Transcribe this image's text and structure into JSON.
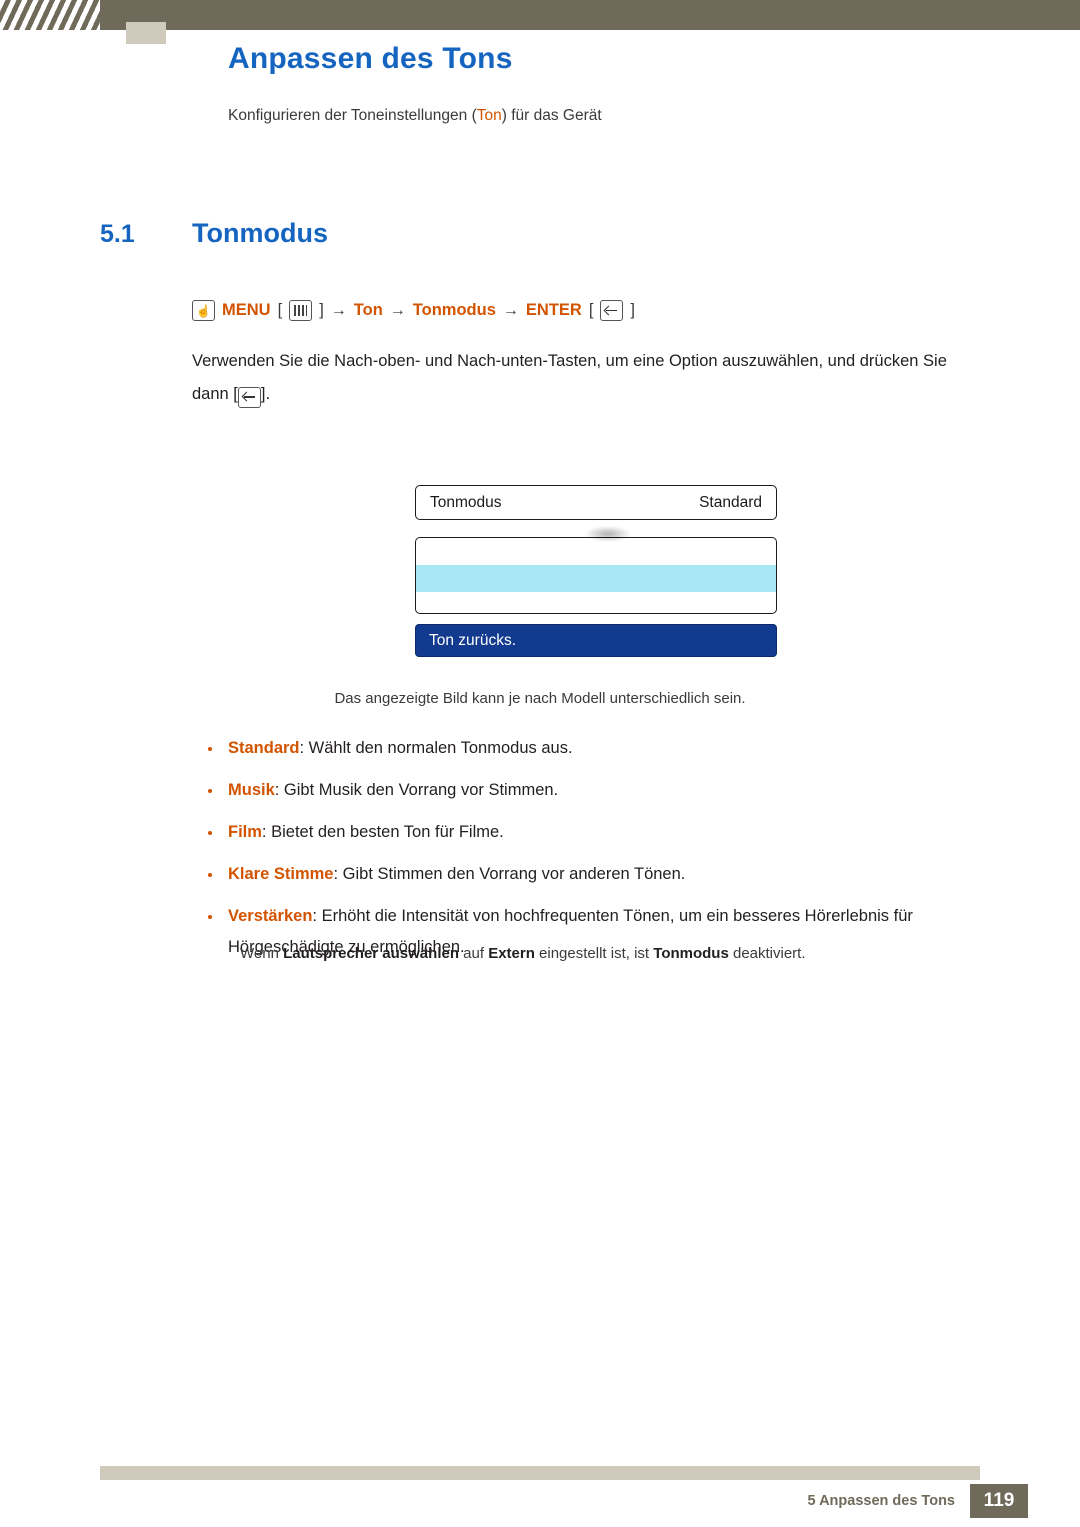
{
  "header": {
    "chapter_title": "Anpassen des Tons",
    "chapter_subtitle_pre": "Konfigurieren der Toneinstellungen (",
    "chapter_subtitle_hl": "Ton",
    "chapter_subtitle_post": ") für das Gerät"
  },
  "section": {
    "number": "5.1",
    "title": "Tonmodus"
  },
  "path": {
    "menu_label": "MENU",
    "arrow": "→",
    "step2": "Ton",
    "step3": "Tonmodus",
    "enter_label": "ENTER",
    "bracket_open": "[",
    "bracket_close": "]",
    "hand_icon": "hand-pointer-icon",
    "menu_icon": "menu-bars-icon",
    "enter_icon": "enter-arrow-icon"
  },
  "paragraph": {
    "line1": "Verwenden Sie die Nach-oben- und Nach-unten-Tasten, um eine Option auszuwählen, und drücken Sie",
    "line2_pre": "dann [",
    "line2_post": "]."
  },
  "osd": {
    "row_label": "Tonmodus",
    "row_value": "Standard",
    "bottom_label": "Ton zurücks."
  },
  "caption": "Das angezeigte Bild kann je nach Modell unterschiedlich sein.",
  "bullets": [
    {
      "term": "Standard",
      "text": ": Wählt den normalen Tonmodus aus."
    },
    {
      "term": "Musik",
      "text": ": Gibt Musik den Vorrang vor Stimmen."
    },
    {
      "term": "Film",
      "text": ": Bietet den besten Ton für Filme."
    },
    {
      "term": "Klare Stimme",
      "text": ": Gibt Stimmen den Vorrang vor anderen Tönen."
    },
    {
      "term": "Verstärken",
      "text": ": Erhöht die Intensität von hochfrequenten Tönen, um ein besseres Hörerlebnis für Hörgeschädigte zu ermöglichen."
    }
  ],
  "note": {
    "pre": "Wenn ",
    "b1": "Lautsprecher auswählen",
    "mid1": " auf ",
    "b2": "Extern",
    "mid2": " eingestellt ist, ist ",
    "b3": "Tonmodus",
    "post": " deaktiviert."
  },
  "footer": {
    "text": "5 Anpassen des Tons",
    "page": "119"
  },
  "colors": {
    "accent_blue": "#1565c0",
    "accent_orange": "#d35400",
    "bar_brown": "#6f6a5a",
    "osd_highlight": "#a8e7f5",
    "osd_blue": "#123a8f"
  }
}
